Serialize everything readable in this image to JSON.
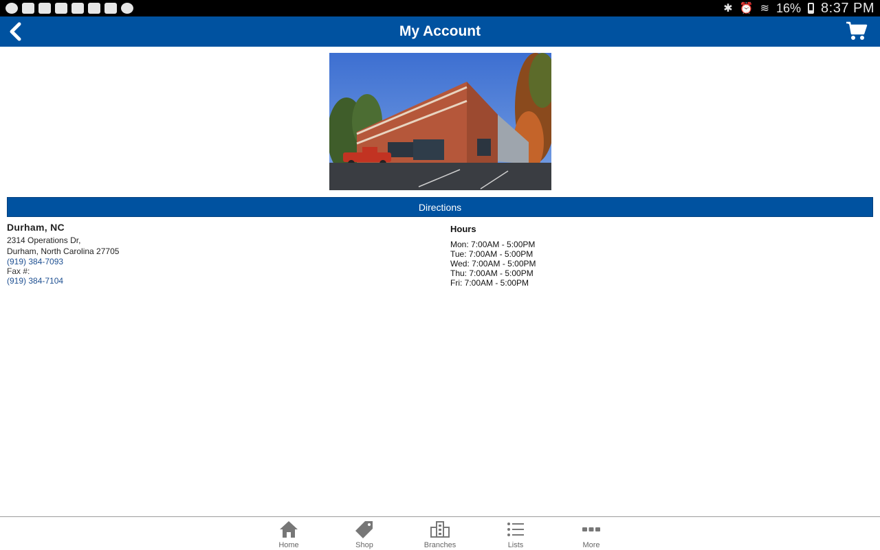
{
  "status_bar": {
    "battery": "16%",
    "time": "8:37 PM",
    "left_icons": [
      "location-icon",
      "screen-cast-icon",
      "stamp-icon",
      "image-icon",
      "facebook-icon",
      "clipboard-check-icon",
      "shop-bag-icon",
      "compass-icon"
    ],
    "right_icons": [
      "bluetooth-icon",
      "alarm-icon",
      "wifi-icon",
      "battery-icon"
    ]
  },
  "app_bar": {
    "title": "My Account",
    "back_icon": "chevron-left-icon",
    "cart_icon": "cart-icon",
    "color": "#0052a0"
  },
  "branch": {
    "photo_icon": "building-photo",
    "directions_label": "Directions",
    "name": "Durham, NC",
    "address_line1": "2314 Operations Dr,",
    "address_line2": "Durham, North Carolina 27705",
    "phone": "(919) 384-7093",
    "fax_label": "Fax #:",
    "fax": "(919) 384-7104"
  },
  "hours": {
    "title": "Hours",
    "lines": [
      "Mon: 7:00AM - 5:00PM",
      "Tue: 7:00AM - 5:00PM",
      "Wed: 7:00AM - 5:00PM",
      "Thu: 7:00AM - 5:00PM",
      "Fri: 7:00AM - 5:00PM"
    ]
  },
  "bottom_nav": {
    "items": [
      {
        "label": "Home",
        "icon": "home-icon"
      },
      {
        "label": "Shop",
        "icon": "tag-icon"
      },
      {
        "label": "Branches",
        "icon": "buildings-icon"
      },
      {
        "label": "Lists",
        "icon": "list-icon"
      },
      {
        "label": "More",
        "icon": "more-icon"
      }
    ]
  }
}
